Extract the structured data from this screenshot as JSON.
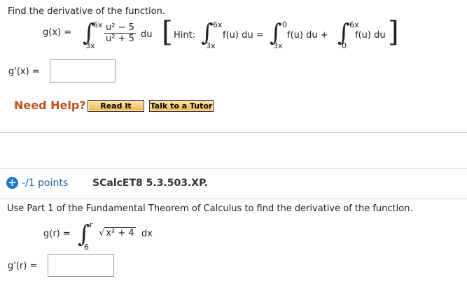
{
  "q1": {
    "instruction": "Find the derivative of the function.",
    "g_lhs": "g(x) =",
    "int_upper": "6x",
    "int_lower": "3x",
    "numerator": "u² − 5",
    "denominator": "u² + 5",
    "du": "du",
    "hint_label": "Hint:",
    "hint_int1_upper": "6x",
    "hint_int1_lower": "3x",
    "hint_f1": "f(u) du =",
    "hint_int2_upper": "0",
    "hint_int2_lower": "3x",
    "hint_f2": "f(u) du +",
    "hint_int3_upper": "6x",
    "hint_int3_lower": "0",
    "hint_f3": "f(u) du",
    "answer_label": "g'(x) =",
    "answer_value": "",
    "need_help": "Need Help?",
    "read_it": "Read It",
    "talk_tutor": "Talk to a Tutor"
  },
  "q2": {
    "points": "-/1 points",
    "question_id": "SCalcET8 5.3.503.XP.",
    "instruction": "Use Part 1 of the Fundamental Theorem of Calculus to find the derivative of the function.",
    "g_lhs": "g(r) =",
    "int_upper": "r",
    "int_lower": "6",
    "radicand": "x² + 4",
    "dx": "dx",
    "answer_label": "g'(r) =",
    "answer_value": ""
  },
  "icons": {
    "expand": "plus-icon"
  },
  "colors": {
    "need_help": "#c0501f",
    "points": "#1a5fa8",
    "plus": "#1a77c9"
  }
}
